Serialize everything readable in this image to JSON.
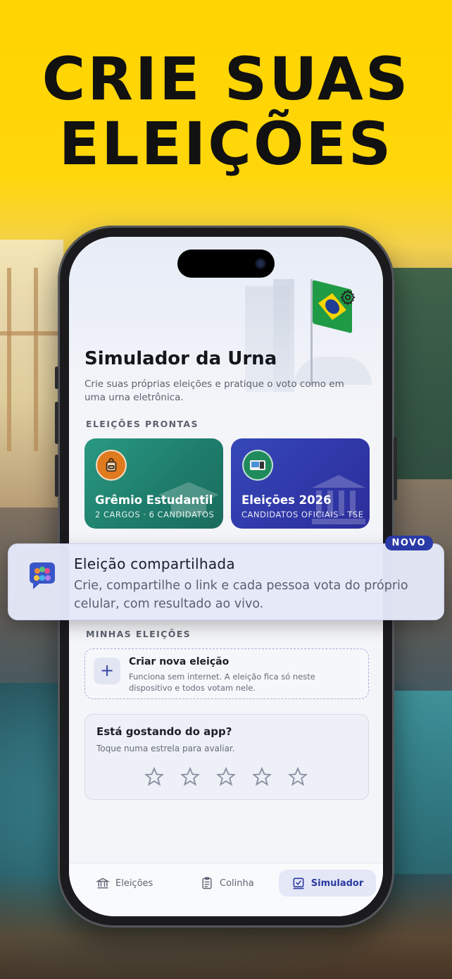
{
  "headline": {
    "line1": "CRIE SUAS",
    "line2": "ELEIÇÕES"
  },
  "app": {
    "title": "Simulador da Urna",
    "subtitle": "Crie suas próprias eleições e pratique o voto como em uma urna eletrônica.",
    "settings_icon": "gear-icon"
  },
  "ready_section": {
    "label": "ELEIÇÕES PRONTAS",
    "cards": [
      {
        "title": "Grêmio Estudantil",
        "meta": "2 CARGOS · 6 CANDIDATOS",
        "icon": "backpack-icon",
        "color": "#1e7d6b"
      },
      {
        "title": "Eleições 2026",
        "meta": "CANDIDATOS OFICIAIS · TSE",
        "icon": "voting-machine-icon",
        "color": "#3038a8"
      }
    ]
  },
  "shared_banner": {
    "title": "Eleição compartilhada",
    "description": "Crie, compartilhe o link e cada pessoa vota do próprio celular, com resultado ao vivo.",
    "badge": "NOVO",
    "icon": "chat-people-icon"
  },
  "my_section": {
    "label": "MINHAS ELEIÇÕES",
    "create": {
      "title": "Criar nova eleição",
      "description": "Funciona sem internet. A eleição fica só neste dispositivo e todos votam nele.",
      "icon": "plus-icon"
    }
  },
  "rating": {
    "title": "Está gostando do app?",
    "description": "Toque numa estrela para avaliar.",
    "stars": 5
  },
  "tabs": [
    {
      "label": "Eleições",
      "icon": "institution-icon",
      "active": false
    },
    {
      "label": "Colinha",
      "icon": "clipboard-icon",
      "active": false
    },
    {
      "label": "Simulador",
      "icon": "ballot-check-icon",
      "active": true
    }
  ],
  "colors": {
    "brand_yellow": "#ffd400",
    "accent": "#2a3aa6"
  }
}
